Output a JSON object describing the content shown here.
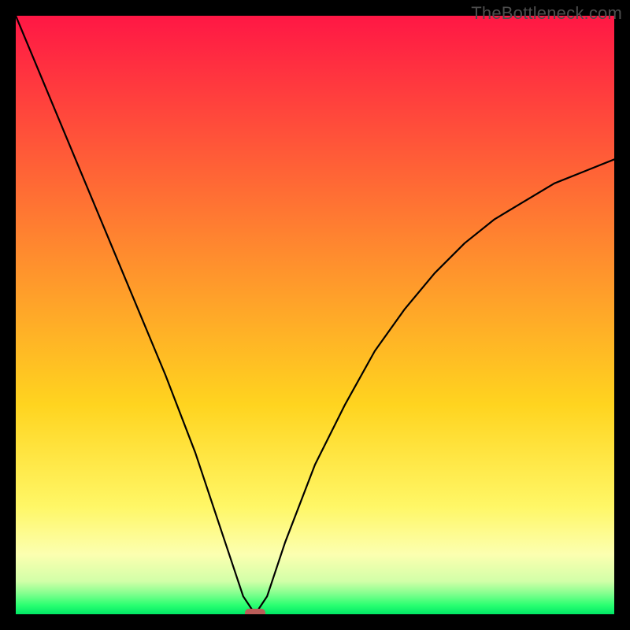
{
  "watermark": "TheBottleneck.com",
  "chart_data": {
    "type": "line",
    "title": "",
    "xlabel": "",
    "ylabel": "",
    "xlim": [
      0,
      100
    ],
    "ylim": [
      0,
      100
    ],
    "grid": false,
    "legend": false,
    "series": [
      {
        "name": "bottleneck-curve",
        "x": [
          0,
          5,
          10,
          15,
          20,
          25,
          30,
          35,
          38,
          40,
          42,
          45,
          50,
          55,
          60,
          65,
          70,
          75,
          80,
          85,
          90,
          95,
          100
        ],
        "values": [
          100,
          88,
          76,
          64,
          52,
          40,
          27,
          12,
          3,
          0,
          3,
          12,
          25,
          35,
          44,
          51,
          57,
          62,
          66,
          69,
          72,
          74,
          76
        ]
      }
    ],
    "marker": {
      "name": "optimal-point",
      "x": 40,
      "y": 0,
      "color": "#bb5d59"
    },
    "gradient_stops": [
      {
        "offset": 0,
        "color": "#ff1745"
      },
      {
        "offset": 0.4,
        "color": "#ff8c2e"
      },
      {
        "offset": 0.65,
        "color": "#ffd41f"
      },
      {
        "offset": 0.82,
        "color": "#fff766"
      },
      {
        "offset": 0.9,
        "color": "#fcffb0"
      },
      {
        "offset": 0.945,
        "color": "#d2ffa8"
      },
      {
        "offset": 0.965,
        "color": "#85ff8f"
      },
      {
        "offset": 0.985,
        "color": "#2aff71"
      },
      {
        "offset": 1.0,
        "color": "#00e765"
      }
    ]
  }
}
